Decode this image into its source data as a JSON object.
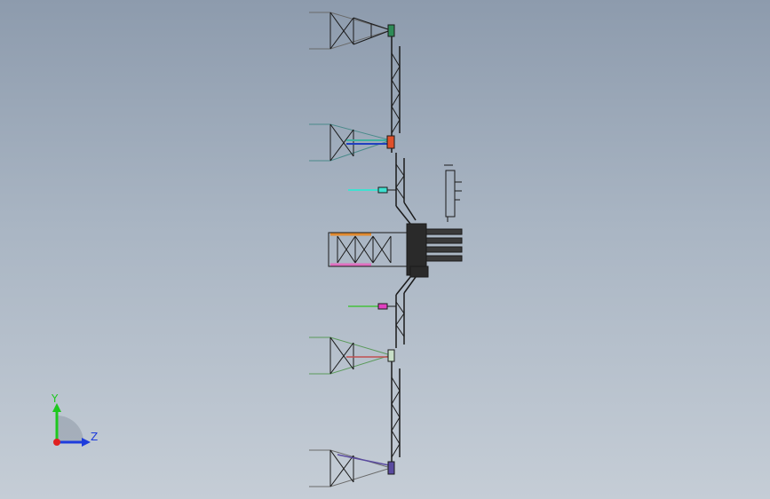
{
  "viewport": {
    "background_top": "#8d9bad",
    "background_bottom": "#c5cdd6"
  },
  "model": {
    "description_icon": "crane-assembly-wireframe",
    "colors": {
      "structure": "#1a1a1a",
      "green_joint": "#2e8b57",
      "red_joint": "#e0502a",
      "cyan_arm": "#40e0d0",
      "magenta_arm": "#e040c0",
      "purple_joint": "#5a4aa0",
      "orange_beam": "#e08a30",
      "pink_beam": "#e070c0",
      "blue_arm": "#2040c0",
      "teal_arm": "#40b0a0",
      "lime_arm": "#60c060"
    }
  },
  "triad": {
    "y_label": "Y",
    "z_label": "Z",
    "y_color": "#1ec81e",
    "z_color": "#1e3cdc",
    "x_color": "#e02020"
  }
}
